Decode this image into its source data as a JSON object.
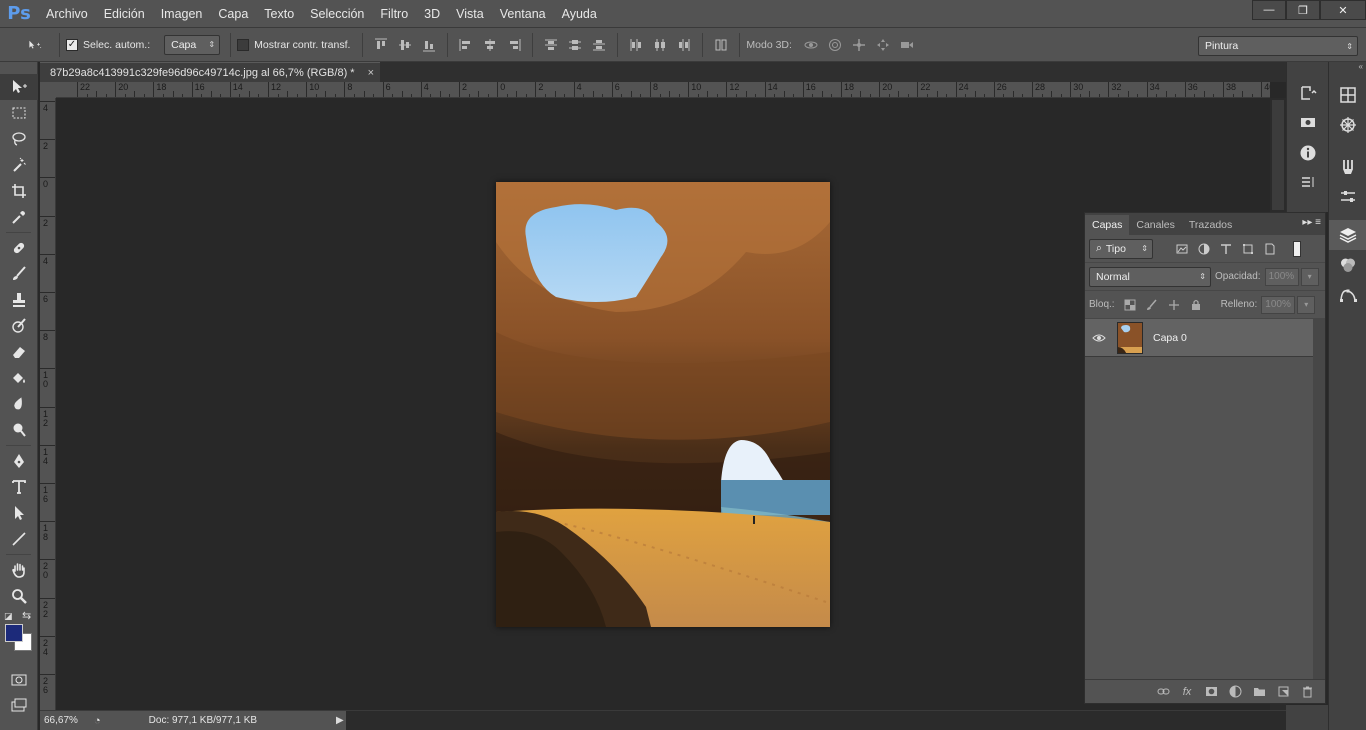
{
  "app": {
    "logo": "Ps"
  },
  "menu": [
    "Archivo",
    "Edición",
    "Imagen",
    "Capa",
    "Texto",
    "Selección",
    "Filtro",
    "3D",
    "Vista",
    "Ventana",
    "Ayuda"
  ],
  "window_controls": {
    "minimize": "—",
    "restore": "❐",
    "close": "✕"
  },
  "options": {
    "auto_select_label": "Selec. autom.:",
    "auto_select_checked": true,
    "target_value": "Capa",
    "transform_label": "Mostrar contr. transf.",
    "transform_checked": false,
    "mode3d_label": "Modo 3D:",
    "workspace": "Pintura"
  },
  "document": {
    "tab_title": "87b29a8c413991c329fe96d96c49714c.jpg al 66,7% (RGB/8) *",
    "close_glyph": "×"
  },
  "rulers": {
    "h_labels": [
      "22",
      "20",
      "18",
      "16",
      "14",
      "12",
      "10",
      "8",
      "6",
      "4",
      "2",
      "0",
      "2",
      "4",
      "6",
      "8",
      "10",
      "12",
      "14",
      "16",
      "18",
      "20",
      "22",
      "24",
      "26",
      "28",
      "30",
      "32",
      "34",
      "36",
      "38",
      "40"
    ],
    "v_labels": [
      "4",
      "2",
      "0",
      "2",
      "4",
      "6",
      "8",
      "1\n0",
      "1\n2",
      "1\n4",
      "1\n6",
      "1\n8",
      "2\n0",
      "2\n2",
      "2\n4",
      "2\n6"
    ]
  },
  "status": {
    "zoom": "66,67%",
    "doc_info": "Doc: 977,1 KB/977,1 KB"
  },
  "layers_panel": {
    "tabs": [
      "Capas",
      "Canales",
      "Trazados"
    ],
    "active_tab": "Capas",
    "filter_kind": "Tipo",
    "blend_mode": "Normal",
    "opacity_label": "Opacidad:",
    "opacity_value": "100%",
    "lock_label": "Bloq.:",
    "fill_label": "Relleno:",
    "fill_value": "100%",
    "layers": [
      {
        "name": "Capa 0",
        "visible": true
      }
    ]
  },
  "colors": {
    "foreground": "#1c2a7a",
    "background": "#ffffff",
    "accent": "#5d9cec"
  },
  "tools": [
    "move-tool",
    "marquee-tool",
    "lasso-tool",
    "magic-wand-tool",
    "crop-tool",
    "eyedropper-tool",
    "healing-brush-tool",
    "brush-tool",
    "clone-stamp-tool",
    "history-brush-tool",
    "eraser-tool",
    "paint-bucket-tool",
    "blur-tool",
    "dodge-tool",
    "pen-tool",
    "type-tool",
    "path-selection-tool",
    "line-tool",
    "hand-tool",
    "zoom-tool"
  ]
}
